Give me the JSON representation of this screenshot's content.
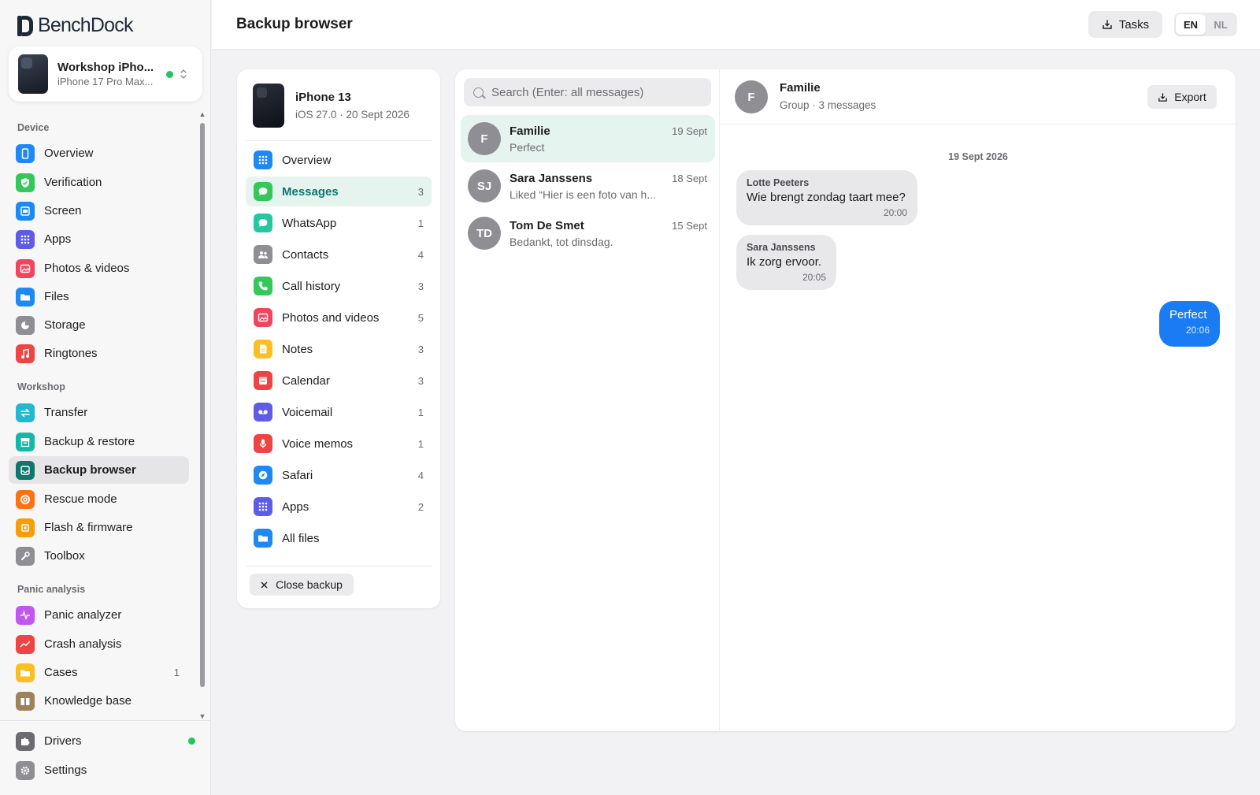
{
  "app": {
    "name": "BenchDock"
  },
  "device": {
    "name": "Workshop iPho...",
    "model": "iPhone 17 Pro Max..."
  },
  "sidebar": {
    "sections": [
      {
        "title": "Device",
        "items": [
          {
            "label": "Overview",
            "icon": "phone-icon",
            "color": "#1e88f5"
          },
          {
            "label": "Verification",
            "icon": "shield-check-icon",
            "color": "#34c759"
          },
          {
            "label": "Screen",
            "icon": "screen-icon",
            "color": "#1e88f5"
          },
          {
            "label": "Apps",
            "icon": "grid-icon",
            "color": "#5e5ce6"
          },
          {
            "label": "Photos & videos",
            "icon": "photo-icon",
            "color": "#f0455f"
          },
          {
            "label": "Files",
            "icon": "folder-icon",
            "color": "#1e88f5"
          },
          {
            "label": "Storage",
            "icon": "pie-icon",
            "color": "#8e8e93"
          },
          {
            "label": "Ringtones",
            "icon": "music-icon",
            "color": "#ef4444"
          }
        ]
      },
      {
        "title": "Workshop",
        "items": [
          {
            "label": "Transfer",
            "icon": "transfer-icon",
            "color": "#22b8cf"
          },
          {
            "label": "Backup & restore",
            "icon": "archive-icon",
            "color": "#14b8a6"
          },
          {
            "label": "Backup browser",
            "icon": "inbox-icon",
            "color": "#0f766e"
          },
          {
            "label": "Rescue mode",
            "icon": "lifebuoy-icon",
            "color": "#f97316"
          },
          {
            "label": "Flash & firmware",
            "icon": "chip-icon",
            "color": "#f59e0b"
          },
          {
            "label": "Toolbox",
            "icon": "wrench-icon",
            "color": "#8e8e93"
          }
        ]
      },
      {
        "title": "Panic analysis",
        "items": [
          {
            "label": "Panic analyzer",
            "icon": "pulse-icon",
            "color": "#c058f0"
          },
          {
            "label": "Crash analysis",
            "icon": "chart-down-icon",
            "color": "#ef4444"
          },
          {
            "label": "Cases",
            "icon": "folder-icon",
            "color": "#fbbf24",
            "count": "1"
          },
          {
            "label": "Knowledge base",
            "icon": "book-icon",
            "color": "#a0825a"
          }
        ]
      }
    ],
    "bottom": [
      {
        "label": "Drivers",
        "icon": "puzzle-icon",
        "color": "#6b6b70"
      },
      {
        "label": "Settings",
        "icon": "gear-icon",
        "color": "#8e8e93"
      }
    ]
  },
  "header": {
    "title": "Backup browser",
    "tasks_label": "Tasks",
    "lang": [
      "EN",
      "NL"
    ],
    "lang_selected": "EN"
  },
  "backup": {
    "name": "iPhone 13",
    "sub": "iOS 27.0 · 20 Sept 2026",
    "categories": [
      {
        "label": "Overview",
        "icon": "grid-icon",
        "color": "#1e88f5",
        "count": ""
      },
      {
        "label": "Messages",
        "icon": "message-icon",
        "color": "#34c759",
        "count": "3"
      },
      {
        "label": "WhatsApp",
        "icon": "whatsapp-icon",
        "color": "#25c7a0",
        "count": "1"
      },
      {
        "label": "Contacts",
        "icon": "people-icon",
        "color": "#8e8e93",
        "count": "4"
      },
      {
        "label": "Call history",
        "icon": "phone-call-icon",
        "color": "#34c759",
        "count": "3"
      },
      {
        "label": "Photos and videos",
        "icon": "photo-icon",
        "color": "#f0455f",
        "count": "5"
      },
      {
        "label": "Notes",
        "icon": "note-icon",
        "color": "#fbbf24",
        "count": "3"
      },
      {
        "label": "Calendar",
        "icon": "calendar-icon",
        "color": "#ef4444",
        "count": "3"
      },
      {
        "label": "Voicemail",
        "icon": "voicemail-icon",
        "color": "#5e5ce6",
        "count": "1"
      },
      {
        "label": "Voice memos",
        "icon": "mic-icon",
        "color": "#ef4444",
        "count": "1"
      },
      {
        "label": "Safari",
        "icon": "compass-icon",
        "color": "#1e88f5",
        "count": "4"
      },
      {
        "label": "Apps",
        "icon": "grid-icon",
        "color": "#5e5ce6",
        "count": "2"
      },
      {
        "label": "All files",
        "icon": "folder-icon",
        "color": "#1e88f5",
        "count": ""
      }
    ],
    "close_label": "Close backup"
  },
  "messages": {
    "search_placeholder": "Search (Enter: all messages)",
    "threads": [
      {
        "initials": "F",
        "name": "Familie",
        "preview": "Perfect",
        "date": "19 Sept"
      },
      {
        "initials": "SJ",
        "name": "Sara Janssens",
        "preview": "Liked “Hier is een foto van h...",
        "date": "18 Sept"
      },
      {
        "initials": "TD",
        "name": "Tom De Smet",
        "preview": "Bedankt, tot dinsdag.",
        "date": "15 Sept"
      }
    ],
    "conversation": {
      "initials": "F",
      "name": "Familie",
      "sub": "Group · 3 messages",
      "export_label": "Export",
      "day": "19 Sept 2026",
      "items": [
        {
          "sender": "Lotte Peeters",
          "text": "Wie brengt zondag taart mee?",
          "time": "20:00"
        },
        {
          "sender": "Sara Janssens",
          "text": "Ik zorg ervoor.",
          "time": "20:05"
        },
        {
          "sender": "",
          "text": "Perfect",
          "time": "20:06"
        }
      ]
    }
  }
}
